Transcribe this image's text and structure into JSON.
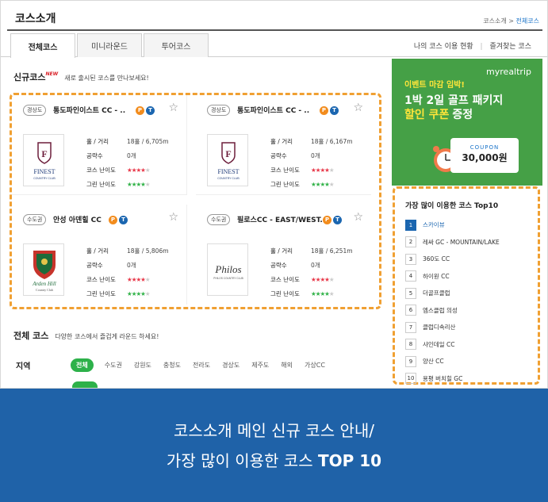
{
  "header": {
    "title": "코스소개",
    "breadcrumb_parent": "코스소개",
    "breadcrumb_sep": ">",
    "breadcrumb_current": "전체코스"
  },
  "tabs": [
    {
      "label": "전체코스"
    },
    {
      "label": "미니라운드"
    },
    {
      "label": "투어코스"
    }
  ],
  "right_links": {
    "history": "나의 코스 이용 현황",
    "favorites": "즐겨찾는 코스",
    "sep": "|"
  },
  "new_courses": {
    "title": "신규코스",
    "badge": "NEW",
    "desc": "새로 출시된 코스를 만나보세요!",
    "labels": {
      "hole": "홀 / 거리",
      "attack": "공략수",
      "difficulty": "코스 난이도",
      "green": "그린 난이도"
    },
    "cards": [
      {
        "region": "경상도",
        "name": "통도파인이스트 CC - ..",
        "hole": "18홀 / 6,705m",
        "attack": "0개",
        "course_difficulty": 4,
        "green_difficulty": 4,
        "logo": "FINEST",
        "logo_sub": "COUNTRY CLUB"
      },
      {
        "region": "경상도",
        "name": "통도파인이스트 CC - ..",
        "hole": "18홀 / 6,167m",
        "attack": "0개",
        "course_difficulty": 4,
        "green_difficulty": 4,
        "logo": "FINEST",
        "logo_sub": "COUNTRY CLUB"
      },
      {
        "region": "수도권",
        "name": "안성 아덴힐 CC",
        "hole": "18홀 / 5,806m",
        "attack": "0개",
        "course_difficulty": 4,
        "green_difficulty": 4,
        "logo": "Arden Hill",
        "logo_sub": "Country Club"
      },
      {
        "region": "수도권",
        "name": "필로스CC - EAST/WEST..",
        "hole": "18홀 / 6,251m",
        "attack": "0개",
        "course_difficulty": 4,
        "green_difficulty": 4,
        "logo": "Philos",
        "logo_sub": "PHILOS COUNTRY CLUB"
      }
    ]
  },
  "all_courses": {
    "title": "전체 코스",
    "desc": "다양한 코스에서 즐겁게 라운드 하세요!",
    "region_label": "지역",
    "regions": [
      "전체",
      "수도권",
      "강원도",
      "충청도",
      "전라도",
      "경상도",
      "제주도",
      "해외",
      "가상CC"
    ]
  },
  "ad": {
    "brand": "myrealtrip",
    "line1": "이벤트 마감 임박!",
    "line2": "1박 2일 골프 패키지",
    "line3": "할인 쿠폰",
    "line3b": "증정",
    "coupon_label": "COUPON",
    "coupon_amount": "30,000원"
  },
  "top10": {
    "title": "가장 많이 이용한 코스 Top10",
    "items": [
      {
        "rank": "1",
        "name": "스카이뷰"
      },
      {
        "rank": "2",
        "name": "레싸 GC - MOUNTAIN/LAKE"
      },
      {
        "rank": "3",
        "name": "360도 CC"
      },
      {
        "rank": "4",
        "name": "하이원 CC"
      },
      {
        "rank": "5",
        "name": "더골프클럽"
      },
      {
        "rank": "6",
        "name": "엠스클럽 의성"
      },
      {
        "rank": "7",
        "name": "클럽디속리산"
      },
      {
        "rank": "8",
        "name": "샤인데일 CC"
      },
      {
        "rank": "9",
        "name": "양산 CC"
      },
      {
        "rank": "10",
        "name": "용평 버치힐 GC"
      }
    ]
  },
  "caption": {
    "line1": "코스소개 메인 신규 코스 안내/",
    "line2_pre": "가장 많이 이용한 코스",
    "line2_bold": "TOP 10"
  },
  "colors": {
    "accent_blue": "#1f62a8",
    "highlight": "#f0a032",
    "green": "#2db14a",
    "ad_bg": "#45a046"
  }
}
